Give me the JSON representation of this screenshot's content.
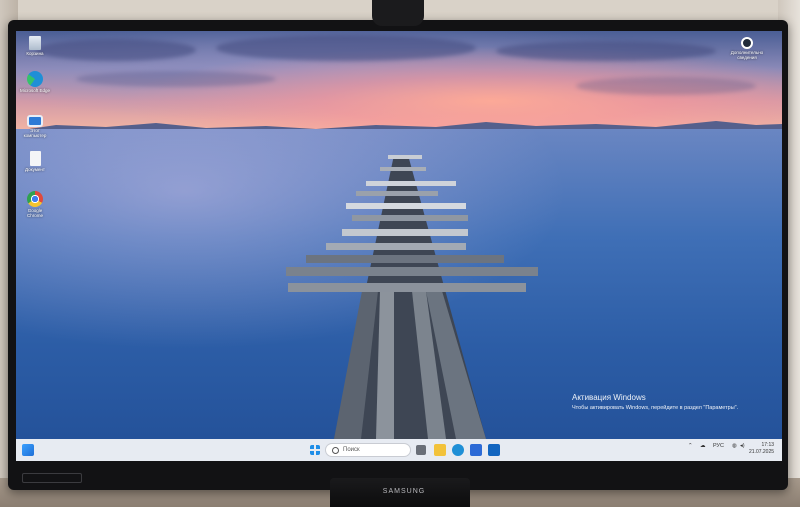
{
  "desktop": {
    "icons": [
      {
        "label": "Корзина",
        "icon": "recycle-bin-icon"
      },
      {
        "label": "Microsoft Edge",
        "icon": "edge-icon"
      },
      {
        "label": "Этот компьютер",
        "icon": "this-pc-icon"
      },
      {
        "label": "Документ",
        "icon": "document-icon"
      },
      {
        "label": "Google Chrome",
        "icon": "chrome-icon"
      }
    ],
    "corner_icon": {
      "label": "Дополнительно сведения",
      "icon": "info-corner-icon"
    }
  },
  "watermark": {
    "title": "Активация Windows",
    "subtitle": "Чтобы активировать Windows, перейдите в раздел \"Параметры\"."
  },
  "taskbar": {
    "search_placeholder": "Поиск",
    "language": "РУС",
    "time": "17:13",
    "date": "21.07.2025"
  },
  "monitor": {
    "brand": "SAMSUNG"
  },
  "colors": {
    "taskbar_bg": "#eef0f5",
    "edge": "#1f8fd6",
    "chrome_red": "#e04a3c",
    "chrome_yellow": "#f4c430",
    "chrome_green": "#2fa24f",
    "chrome_blue": "#3e7ef0",
    "folder": "#f2c23a",
    "store": "#2c6ad6",
    "outlook": "#1265c0"
  }
}
